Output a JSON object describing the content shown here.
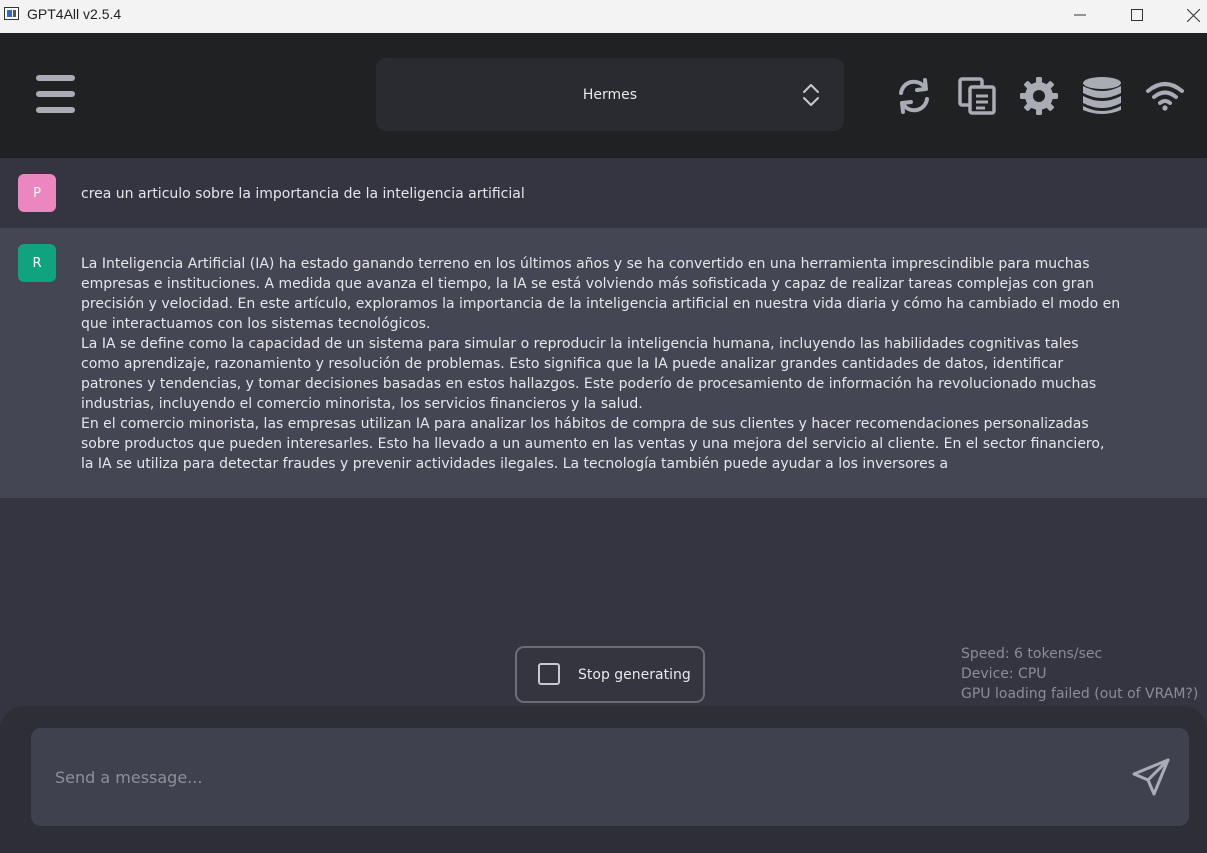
{
  "window": {
    "title": "GPT4All v2.5.4"
  },
  "header": {
    "model_selected": "Hermes"
  },
  "messages": {
    "prompt": {
      "avatar_letter": "P",
      "text": "crea un articulo sobre la importancia de la inteligencia artificial"
    },
    "response": {
      "avatar_letter": "R",
      "text": "La Inteligencia Artificial (IA) ha estado ganando terreno en los últimos años y se ha convertido en una herramienta imprescindible para muchas empresas e instituciones. A medida que avanza el tiempo, la IA se está volviendo más sofisticada y capaz de realizar tareas complejas con gran precisión y velocidad. En este artículo, exploramos la importancia de la inteligencia artificial en nuestra vida diaria y cómo ha cambiado el modo en que interactuamos con los sistemas tecnológicos.\nLa IA se define como la capacidad de un sistema para simular o reproducir la inteligencia humana, incluyendo las habilidades cognitivas tales como aprendizaje, razonamiento y resolución de problemas. Esto significa que la IA puede analizar grandes cantidades de datos, identificar patrones y tendencias, y tomar decisiones basadas en estos hallazgos. Este poderío de procesamiento de información ha revolucionado muchas industrias, incluyendo el comercio minorista, los servicios financieros y la salud.\nEn el comercio minorista, las empresas utilizan IA para analizar los hábitos de compra de sus clientes y hacer recomendaciones personalizadas sobre productos que pueden interesarles. Esto ha llevado a un aumento en las ventas y una mejora del servicio al cliente. En el sector financiero, la IA se utiliza para detectar fraudes y prevenir actividades ilegales. La tecnología también puede ayudar a los inversores a"
    }
  },
  "controls": {
    "stop_label": "Stop generating"
  },
  "stats": {
    "speed": "Speed: 6 tokens/sec",
    "device": "Device: CPU",
    "gpu": "GPU loading failed (out of VRAM?)"
  },
  "input": {
    "placeholder": "Send a message..."
  },
  "colors": {
    "prompt_avatar": "#ec86c0",
    "response_avatar": "#10a37f",
    "icon_gray": "#a9abb5"
  },
  "icons": {
    "menu": "hamburger-icon",
    "regenerate": "refresh-icon",
    "copy": "copy-icon",
    "settings": "gear-icon",
    "database": "database-icon",
    "network": "wifi-icon",
    "send": "send-icon"
  }
}
